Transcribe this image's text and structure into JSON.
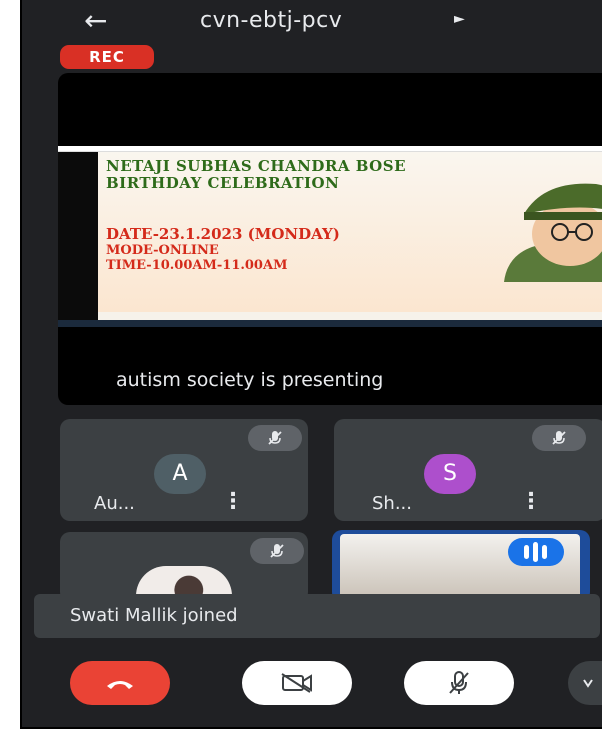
{
  "header": {
    "back_icon": "arrow-left-icon",
    "title": "cvn-ebtj-pcv",
    "caret_icon": "play-arrow-icon"
  },
  "recording": {
    "label": "REC",
    "color": "#d93025"
  },
  "presentation": {
    "slide": {
      "line1": "NETAJI SUBHAS CHANDRA BOSE",
      "line2": "BIRTHDAY CELEBRATION",
      "date": "DATE-23.1.2023 (MONDAY)",
      "mode": "MODE-ONLINE",
      "time": "TIME-10.00AM-11.00AM"
    },
    "caption": "autism society is presenting"
  },
  "participants": [
    {
      "initial": "A",
      "name": "Au...",
      "muted": true,
      "avatar_color": "#4f5f66"
    },
    {
      "initial": "S",
      "name": "Sh...",
      "muted": true,
      "avatar_color": "#ad4fcc"
    }
  ],
  "toast": {
    "text": "Swati Mallik joined"
  },
  "controls": {
    "end_call_icon": "end-call-icon",
    "camera_icon": "camera-off-icon",
    "mic_icon": "mic-off-icon",
    "more_icon": "more-icon"
  },
  "colors": {
    "background": "#202124",
    "tile": "#3c4043",
    "end_call": "#ea4335",
    "active_speaker": "#1a73e8"
  }
}
